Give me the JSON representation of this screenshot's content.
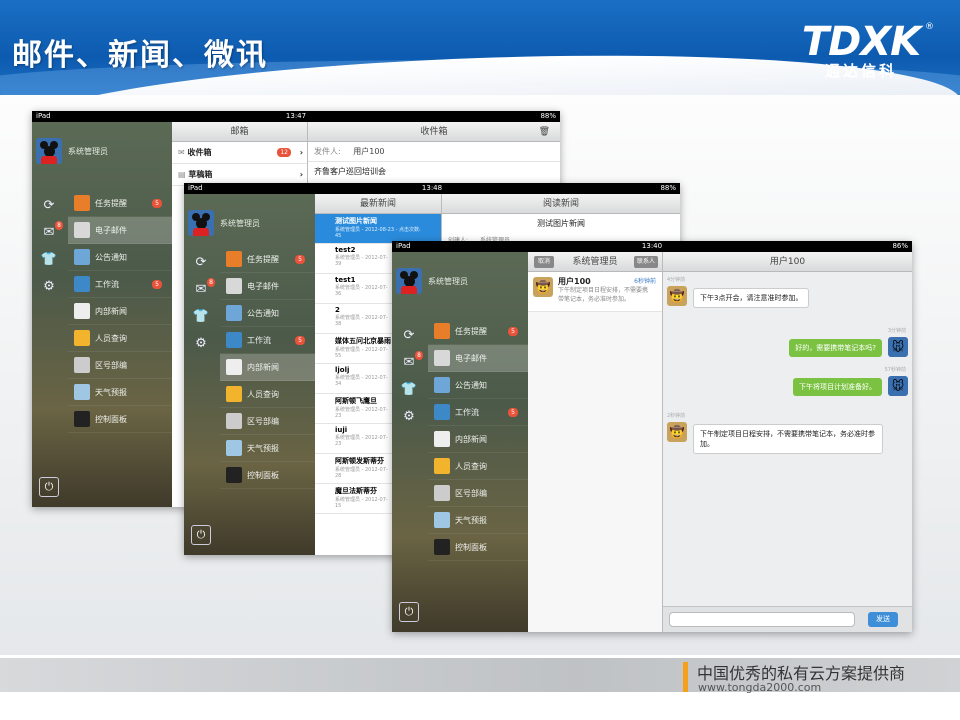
{
  "slide": {
    "title": "邮件、新闻、微讯",
    "logo_mark": "TDXK",
    "logo_reg": "®",
    "logo_cn": "通达信科",
    "footer_cn": "中国优秀的私有云方案提供商",
    "footer_url": "www.tongda2000.com"
  },
  "ipad1": {
    "status": {
      "device": "iPad",
      "time": "13:47",
      "battery": "88%"
    },
    "user": "系统管理员",
    "mail_pane_title": "邮箱",
    "inbox_title": "收件箱",
    "folders": [
      {
        "label": "收件箱",
        "count": "12"
      },
      {
        "label": "草稿箱"
      }
    ],
    "detail": {
      "sender_label": "发件人:",
      "sender": "用户100",
      "subject": "齐鲁客户巡回培训会"
    }
  },
  "ipad2": {
    "status": {
      "device": "iPad",
      "time": "13:48",
      "battery": "88%"
    },
    "user": "系统管理员",
    "news_pane_title": "最新新闻",
    "read_pane_title": "阅读新闻",
    "read_title": "测试图片新闻",
    "read_creator_label": "创建人:",
    "read_creator": "系统管理员",
    "news": [
      {
        "title": "测试图片新闻",
        "meta": "系统管理员 - 2012-08-23 - 点击次数:",
        "count": "45"
      },
      {
        "title": "test2",
        "meta": "系统管理员 - 2012-07-",
        "count": "39"
      },
      {
        "title": "test1",
        "meta": "系统管理员 - 2012-07-",
        "count": "36"
      },
      {
        "title": "2",
        "meta": "系统管理员 - 2012-07-",
        "count": "38"
      },
      {
        "title": "媒体五问北京暴雨",
        "meta": "系统管理员 - 2012-07-",
        "count": "55"
      },
      {
        "title": "ljolj",
        "meta": "系统管理员 - 2012-07-",
        "count": "34"
      },
      {
        "title": "阿斯顿飞鹰旦",
        "meta": "系统管理员 - 2012-07-",
        "count": "23"
      },
      {
        "title": "iuji",
        "meta": "系统管理员 - 2012-07-",
        "count": "23"
      },
      {
        "title": "阿斯顿发斯蒂芬",
        "meta": "系统管理员 - 2012-07-",
        "count": "28"
      },
      {
        "title": "魔旦法斯蒂芬",
        "meta": "系统管理员 - 2012-07-",
        "count": "15"
      }
    ]
  },
  "ipad3": {
    "status": {
      "device": "iPad",
      "time": "13:40",
      "battery": "86%"
    },
    "user": "系统管理员",
    "back_label": "取消",
    "list_title": "系统管理员",
    "add_label": "联系人",
    "conversation": {
      "name": "用户100",
      "time": "6秒钟前",
      "preview": "下午制定项目日程安排，不需要携带笔记本，务必准时参加。"
    },
    "chat_title": "用户100",
    "messages": [
      {
        "side": "left",
        "time": "4分钟前",
        "text": "下午3点开会，请注意准时参加。"
      },
      {
        "side": "right",
        "time": "3分钟前",
        "text": "好的，需要携带笔记本吗?"
      },
      {
        "side": "right",
        "time": "57秒钟前",
        "text": "下午将项目计划准备好。"
      },
      {
        "side": "left",
        "time": "2秒钟前",
        "text": "下午制定项目日程安排，不需要携带笔记本，务必准时参加。"
      }
    ],
    "send_label": "发送"
  },
  "menu": [
    {
      "label": "任务提醒",
      "badge": "5",
      "icon": "task-icon",
      "color": "#e87d2a"
    },
    {
      "label": "电子邮件",
      "badge": "",
      "icon": "email-icon",
      "color": "#d8d8d8"
    },
    {
      "label": "公告通知",
      "badge": "",
      "icon": "notice-icon",
      "color": "#6fa6d8"
    },
    {
      "label": "工作流",
      "badge": "5",
      "icon": "workflow-icon",
      "color": "#3d88c6"
    },
    {
      "label": "内部新闻",
      "badge": "",
      "icon": "news-icon",
      "color": "#eeeeee"
    },
    {
      "label": "人员查询",
      "badge": "",
      "icon": "people-icon",
      "color": "#f2b32d"
    },
    {
      "label": "区号部编",
      "badge": "",
      "icon": "phone-book-icon",
      "color": "#cccccc"
    },
    {
      "label": "天气预报",
      "badge": "",
      "icon": "weather-icon",
      "color": "#9fc6e3"
    },
    {
      "label": "控制面板",
      "badge": "",
      "icon": "control-panel-icon",
      "color": "#222222"
    }
  ],
  "menu_badge_mail": "8"
}
